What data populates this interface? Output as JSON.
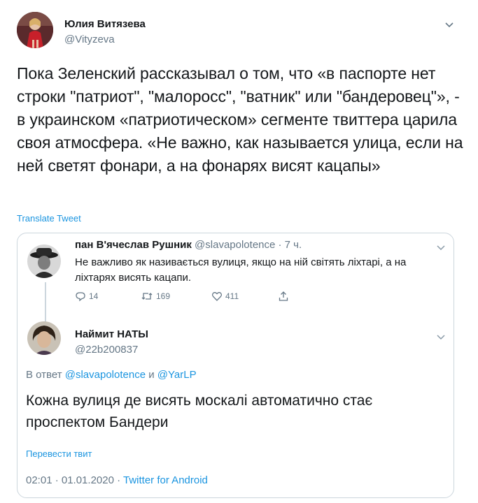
{
  "author": {
    "name": "Юлия Витязева",
    "handle": "@Vityzeva"
  },
  "tweet": {
    "text": "Пока Зеленский рассказывал о том, что «в паспорте нет строки \"патриот\", \"малоросс\", \"ватник\" или \"бандеровец\"», - в украинском «патриотическом» сегменте твиттера царила своя атмосфера. «Не важно, как называется улица, если на ней светят фонари, а на фонарях висят кацапы»",
    "translate_label": "Translate Tweet"
  },
  "quoted_first": {
    "name": "пан В'ячеслав Рушник",
    "handle_time": "@slavapolotence · 7 ч.",
    "text": "Не важливо як називається вулиця, якщо на ній світять ліхтарі, а на ліхтарях висять кацапи.",
    "replies": "14",
    "retweets": "169",
    "likes": "411"
  },
  "quoted_second": {
    "name": "Наймит НАТЫ",
    "handle": "@22b200837",
    "reply_prefix": "В ответ ",
    "reply_user1": "@slavapolotence",
    "reply_and": " и ",
    "reply_user2": "@YarLP",
    "text": "Кожна вулиця де висять москалі автоматично стає проспектом Бандери",
    "translate_label": "Перевести твит",
    "time": "02:01 · 01.01.2020 · ",
    "source": "Twitter for Android"
  },
  "colors": {
    "link": "#1b95e0",
    "muted": "#657786",
    "text": "#14171a",
    "border": "#ccd6dd"
  },
  "icons": [
    "chevron-down-icon",
    "reply-icon",
    "retweet-icon",
    "like-icon",
    "share-icon"
  ]
}
